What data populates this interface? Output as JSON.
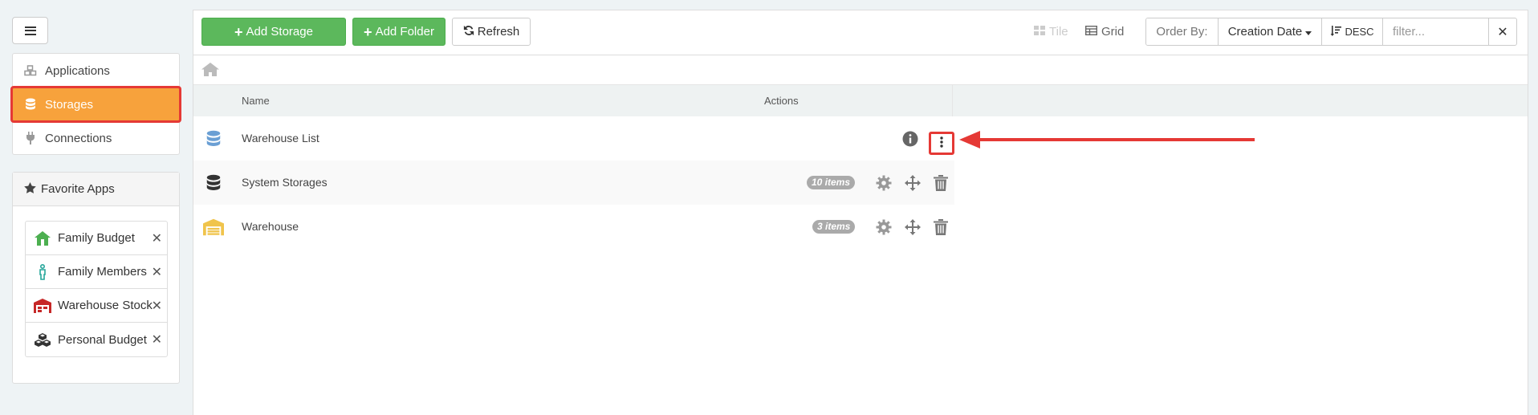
{
  "sidebar": {
    "nav": [
      {
        "label": "Applications",
        "icon": "cubes-icon",
        "active": false
      },
      {
        "label": "Storages",
        "icon": "database-icon",
        "active": true
      },
      {
        "label": "Connections",
        "icon": "plug-icon",
        "active": false
      }
    ],
    "favorites_title": "Favorite Apps",
    "favorites": [
      {
        "label": "Family Budget",
        "icon": "house-icon"
      },
      {
        "label": "Family Members",
        "icon": "person-icon"
      },
      {
        "label": "Warehouse Stock",
        "icon": "warehouse-icon"
      },
      {
        "label": "Personal Budget",
        "icon": "cubes-icon"
      }
    ],
    "remove_symbol": "✕"
  },
  "toolbar": {
    "add_storage": "Add Storage",
    "add_folder": "Add Folder",
    "refresh": "Refresh",
    "view_tile": "Tile",
    "view_grid": "Grid",
    "order_by_label": "Order By:",
    "order_by_value": "Creation Date",
    "direction": "DESC",
    "filter_placeholder": "filter...",
    "clear_symbol": "✕"
  },
  "table": {
    "headers": {
      "name": "Name",
      "actions": "Actions"
    },
    "rows": [
      {
        "name": "Warehouse List",
        "icon": "database-icon",
        "badge": ""
      },
      {
        "name": "System Storages",
        "icon": "database-icon",
        "badge": "10 items"
      },
      {
        "name": "Warehouse",
        "icon": "warehouse-icon",
        "badge": "3 items"
      }
    ]
  },
  "colors": {
    "accent_orange": "#f7a23c",
    "highlight_red": "#e53935",
    "button_green": "#5cb85c"
  }
}
